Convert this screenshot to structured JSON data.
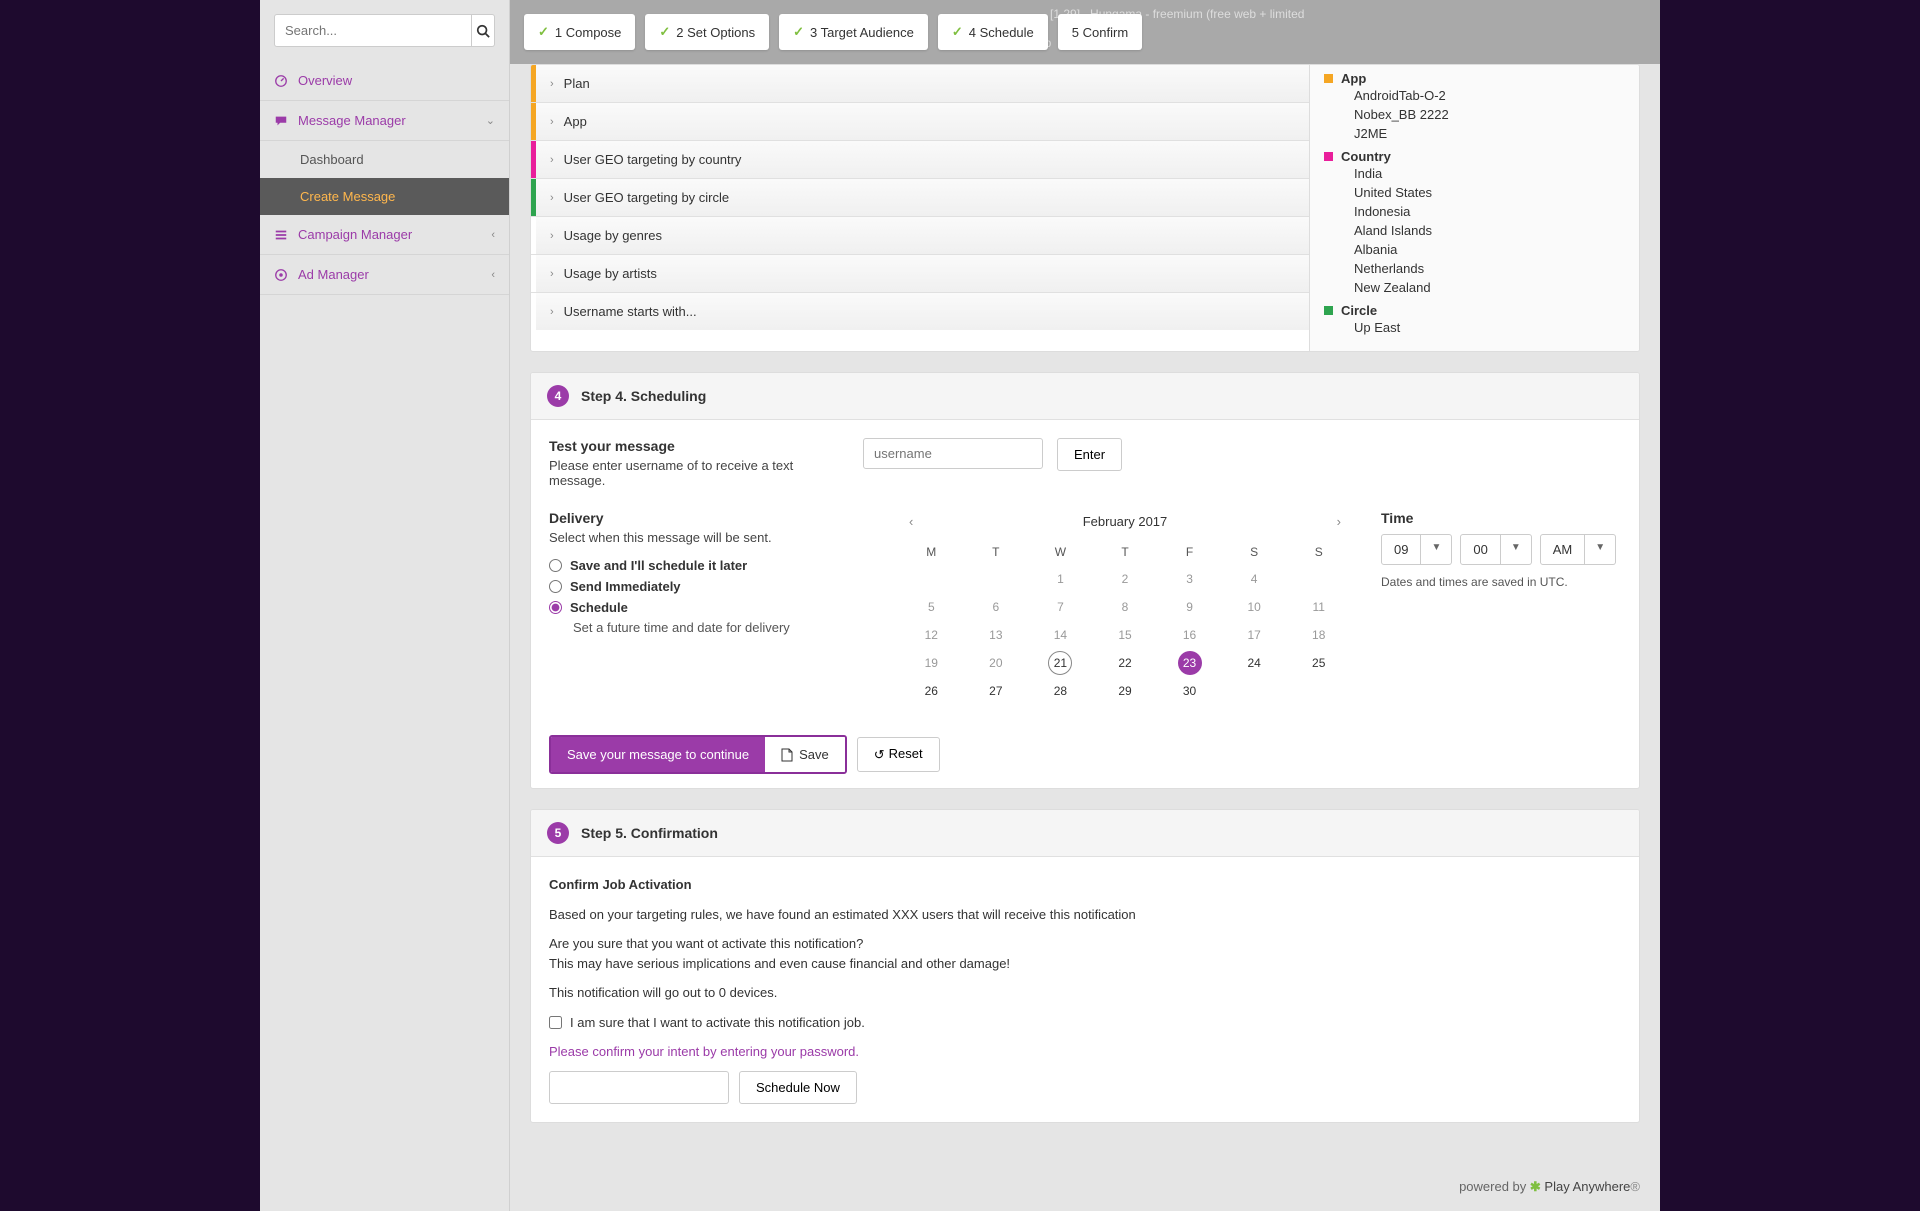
{
  "search": {
    "placeholder": "Search..."
  },
  "nav": {
    "overview": "Overview",
    "message_manager": "Message Manager",
    "dashboard": "Dashboard",
    "create_message": "Create Message",
    "campaign_manager": "Campaign Manager",
    "ad_manager": "Ad Manager"
  },
  "steps": {
    "s1": "1 Compose",
    "s2": "2 Set Options",
    "s3": "3 Target Audience",
    "s4": "4 Schedule",
    "s5": "5 Confirm"
  },
  "ghost": {
    "line1": "[1,29] . Hungama - freemium (free web + limited",
    "line2": "App"
  },
  "accordion": {
    "plan": "Plan",
    "app": "App",
    "geo_country": "User GEO targeting by country",
    "geo_circle": "User GEO targeting by circle",
    "genres": "Usage by genres",
    "artists": "Usage by artists",
    "username": "Username starts with..."
  },
  "accordion_colors": {
    "plan": "#f5a623",
    "app": "#f5a623",
    "geo_country": "#e91e9b",
    "geo_circle": "#2ea44f",
    "genres": "",
    "artists": "",
    "username": ""
  },
  "summary": {
    "app_head": "App",
    "app_color": "#f5a623",
    "app_items": [
      "AndroidTab-O-2",
      "Nobex_BB 2222",
      "J2ME"
    ],
    "country_head": "Country",
    "country_color": "#e91e9b",
    "country_items": [
      "India",
      "United States",
      "Indonesia",
      "Aland Islands",
      "Albania",
      "Netherlands",
      "New Zealand"
    ],
    "circle_head": "Circle",
    "circle_color": "#2ea44f",
    "circle_items": [
      "Up East"
    ]
  },
  "step4": {
    "header": "Step 4. Scheduling",
    "test_label": "Test your message",
    "test_help": "Please enter username of to receive a text message.",
    "username_placeholder": "username",
    "enter": "Enter",
    "delivery_label": "Delivery",
    "delivery_help": "Select when this message will be sent.",
    "opt_later": "Save and I'll schedule it later",
    "opt_now": "Send Immediately",
    "opt_sched": "Schedule",
    "opt_sched_desc": "Set a future time and date for delivery",
    "cal_title": "February 2017",
    "dow": [
      "M",
      "T",
      "W",
      "T",
      "F",
      "S",
      "S"
    ],
    "days": [
      {
        "n": "",
        "in": false
      },
      {
        "n": "",
        "in": false
      },
      {
        "n": "1",
        "in": false
      },
      {
        "n": "2",
        "in": false
      },
      {
        "n": "3",
        "in": false
      },
      {
        "n": "4",
        "in": false
      },
      {
        "n": "",
        "in": false
      },
      {
        "n": "5",
        "in": false
      },
      {
        "n": "6",
        "in": false
      },
      {
        "n": "7",
        "in": false
      },
      {
        "n": "8",
        "in": false
      },
      {
        "n": "9",
        "in": false
      },
      {
        "n": "10",
        "in": false
      },
      {
        "n": "11",
        "in": false
      },
      {
        "n": "12",
        "in": false
      },
      {
        "n": "13",
        "in": false
      },
      {
        "n": "14",
        "in": false
      },
      {
        "n": "15",
        "in": false
      },
      {
        "n": "16",
        "in": false
      },
      {
        "n": "17",
        "in": false
      },
      {
        "n": "18",
        "in": false
      },
      {
        "n": "19",
        "in": false
      },
      {
        "n": "20",
        "in": false
      },
      {
        "n": "21",
        "in": true,
        "today": true
      },
      {
        "n": "22",
        "in": true
      },
      {
        "n": "23",
        "in": true,
        "sel": true
      },
      {
        "n": "24",
        "in": true
      },
      {
        "n": "25",
        "in": true
      },
      {
        "n": "26",
        "in": true
      },
      {
        "n": "27",
        "in": true
      },
      {
        "n": "28",
        "in": true
      },
      {
        "n": "29",
        "in": true
      },
      {
        "n": "30",
        "in": true
      },
      {
        "n": "",
        "in": false
      },
      {
        "n": "",
        "in": false
      }
    ],
    "time_label": "Time",
    "hour": "09",
    "minute": "00",
    "ampm": "AM",
    "tz_note": "Dates and times are saved in UTC.",
    "save_prompt": "Save your message to continue",
    "save": "Save",
    "reset": "Reset"
  },
  "step5": {
    "header": "Step 5. Confirmation",
    "confirm_head": "Confirm Job Activation",
    "line1": "Based on your targeting rules, we have found an estimated XXX users that will receive this notification",
    "line2": "Are you sure that you want ot activate this notification?",
    "line3": "This may have serious implications and even cause financial and other damage!",
    "line4": "This notification will go out to 0 devices.",
    "check_label": "I am sure that I want to activate this notification job.",
    "password_prompt": "Please confirm your intent by entering your password.",
    "schedule_now": "Schedule Now"
  },
  "footer": {
    "powered": "powered by ",
    "brand": "Play Anywhere"
  }
}
